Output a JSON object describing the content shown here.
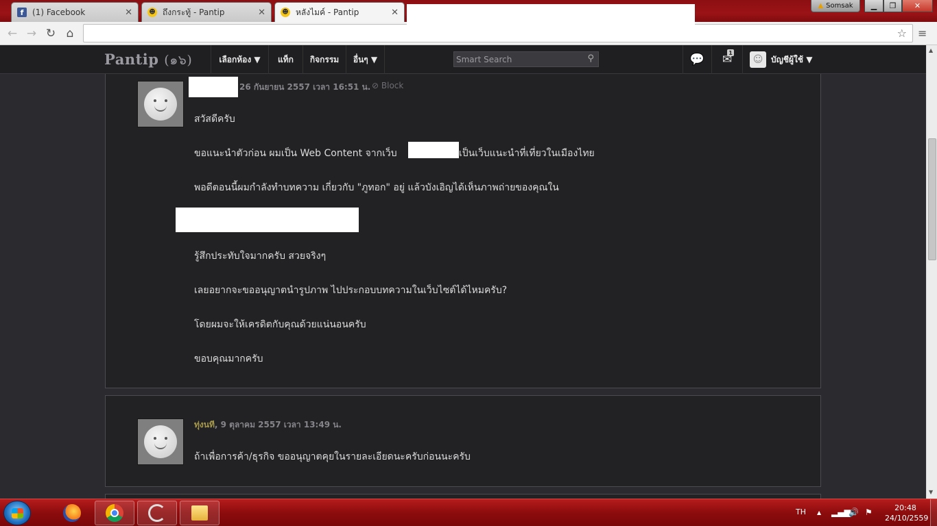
{
  "browser": {
    "tabs": [
      {
        "favicon": "facebook-icon",
        "title": "(1) Facebook"
      },
      {
        "favicon": "pantip-smile-icon",
        "title": "ถึงกระทู้ - Pantip"
      },
      {
        "favicon": "pantip-smile-icon",
        "title": "หลังไมค์ - Pantip"
      }
    ],
    "user_badge": "Somsak",
    "url": ""
  },
  "site": {
    "logo": "Pantip",
    "logo_suffix": "(๑๖)",
    "nav": [
      "เลือกห้อง ▼",
      "แท็ก",
      "กิจกรรม",
      "อื่นๆ ▼"
    ],
    "search_placeholder": "Smart Search",
    "message_count": "1",
    "account_label": "บัญชีผู้ใช้ ▼"
  },
  "messages": [
    {
      "timestamp": "26 กันยายน 2557 เวลา 16:51 น.",
      "block_label": "Block",
      "lines": [
        "สวัสดีครับ",
        "ขอแนะนำตัวก่อน ผมเป็น Web Content จากเว็บ",
        "เป็นเว็บแนะนำที่เที่ยวในเมืองไทย",
        "พอดีตอนนี้ผมกำลังทำบทความ เกี่ยวกับ \"ภูทอก\" อยู่ แล้วบังเอิญได้เห็นภาพถ่ายของคุณใน",
        "รู้สึกประทับใจมากครับ สวยจริงๆ",
        "เลยอยากจะขออนุญาตนำรูปภาพ ไปประกอบบทความในเว็บไซต์ได้ไหมครับ?",
        "โดยผมจะให้เครดิตกับคุณด้วยแน่นอนครับ",
        "ขอบคุณมากครับ"
      ]
    },
    {
      "author": "ทุ่งนที",
      "timestamp": ", 9 ตุลาคม 2557 เวลา 13:49 น.",
      "lines": [
        "ถ้าเพื่อการค้า/ธุรกิจ ขออนุญาตคุยในรายละเอียดนะครับก่อนนะครับ"
      ]
    }
  ],
  "taskbar": {
    "language": "TH",
    "time": "20:48",
    "date": "24/10/2559"
  }
}
